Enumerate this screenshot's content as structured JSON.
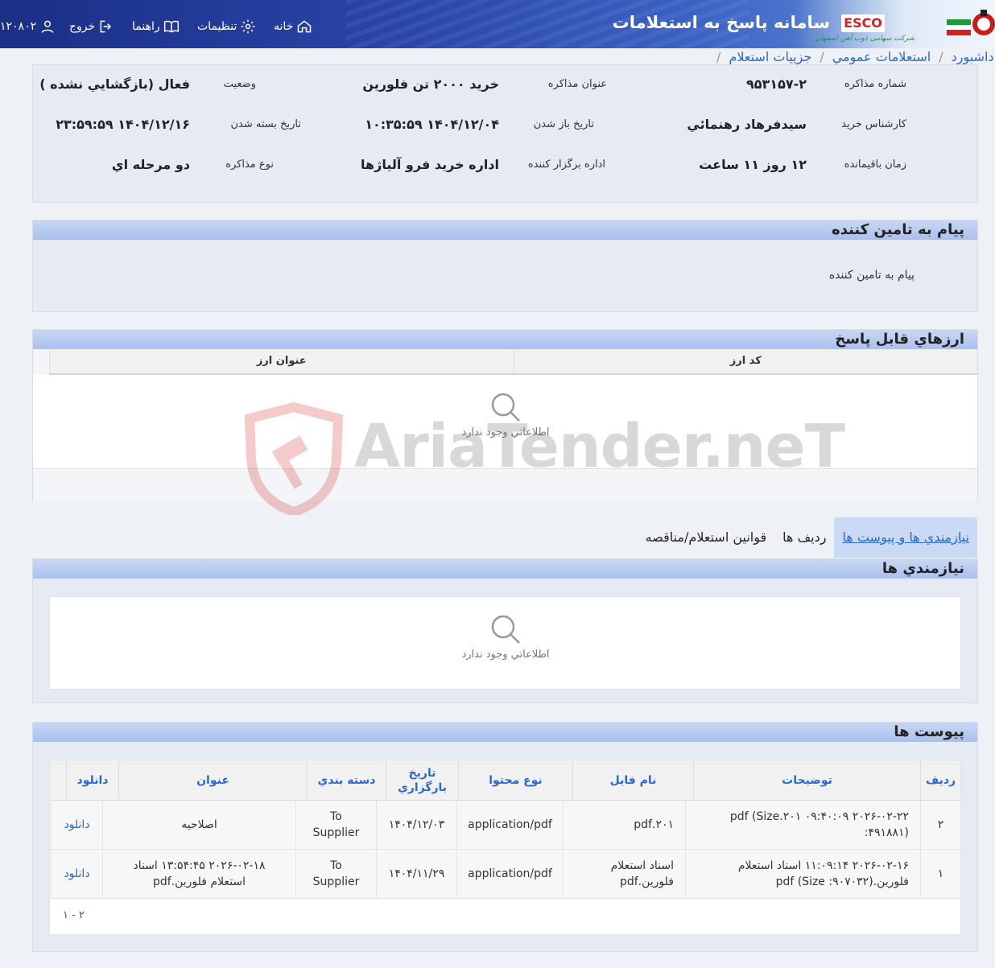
{
  "header": {
    "title": "سامانه پاسخ به استعلامات",
    "brand": "ESCO",
    "company_sub": "شرکت سهامی ذوب آهن اصفهان",
    "nav": {
      "home": "خانه",
      "settings": "تنظیمات",
      "guide": "راهنما",
      "exit": "خروج",
      "user": "۱۲۰۸۰۲"
    }
  },
  "breadcrumb": [
    "ه داشبورد",
    "استعلامات عمومي",
    "جزييات استعلام"
  ],
  "info": {
    "number_label": "شماره مذاکره",
    "number_value": "۹۵۳۱۵۷-۲",
    "subject_label": "عنوان مذاکره",
    "subject_value": "خريد ۲۰۰۰ تن فلورين",
    "status_label": "وضعيت",
    "status_value": "فعال (بازگشايي نشده )",
    "expert_label": "کارشناس خريد",
    "expert_value": "سيدفرهاد رهنمائي",
    "open_label": "تاريخ باز شدن",
    "open_value": "۱۴۰۴/۱۲/۰۴ ۱۰:۳۵:۵۹",
    "close_label": "تاريخ بسته شدن",
    "close_value": "۱۴۰۴/۱۲/۱۶ ۲۳:۵۹:۵۹",
    "remaining_label": "زمان باقيمانده",
    "remaining_value": "۱۲ روز ۱۱ ساعت",
    "dept_label": "اداره برگزار کننده",
    "dept_value": "اداره خريد فرو آلياژها",
    "type_label": "نوع مذاکره",
    "type_value": "دو مرحله اي"
  },
  "message": {
    "title": "پيام به تامين کننده",
    "text": "پيام به تامين کننده"
  },
  "currencies": {
    "title": "ارزهاي قابل پاسخ",
    "columns": [
      "کد ارز",
      "عنوان ارز"
    ],
    "empty": "اطلاعاتي وجود ندارد"
  },
  "tabs": [
    "نيازمندي ها و پيوست ها",
    "رديف ها",
    "قوانين استعلام/مناقصه"
  ],
  "needs": {
    "title": "نيازمندي ها",
    "empty": "اطلاعاتي وجود ندارد"
  },
  "attachments": {
    "title": "پيوست ها",
    "columns": [
      "رديف",
      "توضيحات",
      "نام فايل",
      "نوع محتوا",
      "تاريخ بارگزاري",
      "دسته بندي",
      "عنوان",
      "دانلود"
    ],
    "rows": [
      {
        "index": "۲",
        "desc": "۲۰۲۶-۰۲-۲۲ ۰۹:۴۰:۰۹ ۲۰۱.pdf (Size :۴۹۱۸۸۱)",
        "file": "۲۰۱.pdf",
        "mime": "application/pdf",
        "date": "۱۴۰۴/۱۲/۰۳",
        "category": "To Supplier",
        "title": "اصلاحيه",
        "download": "دانلود"
      },
      {
        "index": "۱",
        "desc": "۲۰۲۶-۰۲-۱۶ ۱۱:۰۹:۱۴ اسناد استعلام فلورين.pdf (Size :۹۰۷۰۳۲)",
        "file": "اسناد استعلام فلورين.pdf",
        "mime": "application/pdf",
        "date": "۱۴۰۴/۱۱/۲۹",
        "category": "To Supplier",
        "title": "۲۰۲۶-۰۲-۱۸ ۱۳:۵۴:۴۵ اسناد استعلام فلورين.pdf",
        "download": "دانلود"
      }
    ],
    "pager": "۱ - ۲"
  },
  "watermark": "AriaTender.neT",
  "colors": {
    "header_dark": "#1a2f86",
    "link_blue": "#2a67d1",
    "panel_head": "#a9c0ee"
  }
}
